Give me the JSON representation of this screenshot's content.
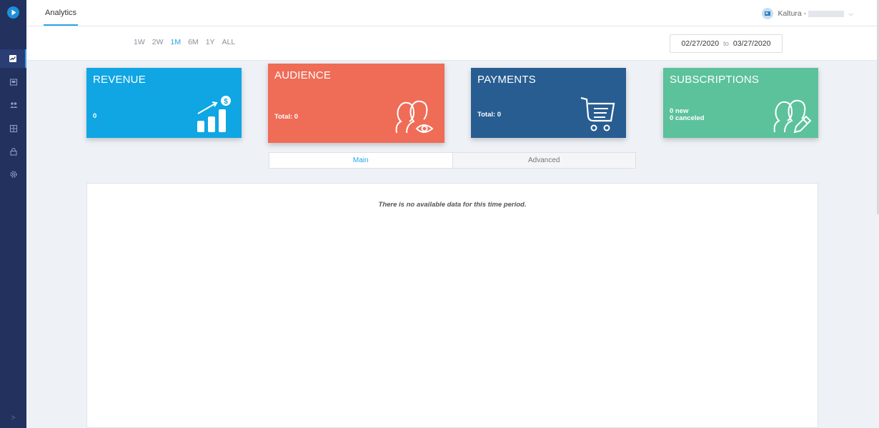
{
  "header": {
    "tab_label": "Analytics",
    "account_label": "Kaltura -"
  },
  "toolbar": {
    "periods": [
      {
        "label": "1W",
        "active": false
      },
      {
        "label": "2W",
        "active": false
      },
      {
        "label": "1M",
        "active": true
      },
      {
        "label": "6M",
        "active": false
      },
      {
        "label": "1Y",
        "active": false
      },
      {
        "label": "ALL",
        "active": false
      }
    ],
    "date_from": "02/27/2020",
    "date_sep": "to",
    "date_to": "03/27/2020"
  },
  "cards": {
    "revenue": {
      "title": "REVENUE",
      "value": "0",
      "color": "#0fa6e3",
      "icon": "revenue-growth-icon"
    },
    "audience": {
      "title": "AUDIENCE",
      "value": "Total: 0",
      "color": "#ef6c57",
      "icon": "audience-eye-icon"
    },
    "payments": {
      "title": "PAYMENTS",
      "value": "Total: 0",
      "color": "#275d91",
      "icon": "shopping-cart-icon"
    },
    "subscriptions": {
      "title": "SUBSCRIPTIONS",
      "value_new": "0 new",
      "value_canceled": "0 canceled",
      "color": "#5cc29b",
      "icon": "users-edit-icon"
    }
  },
  "subtabs": {
    "main": "Main",
    "advanced": "Advanced"
  },
  "panel": {
    "empty_message": "There is no available data for this time period."
  },
  "sidebar": {
    "icons": [
      "logo-play-icon",
      "dashboard-icon",
      "media-icon",
      "users-icon",
      "grid-icon",
      "lock-icon",
      "settings-icon"
    ],
    "expand_glyph": ">"
  },
  "colors": {
    "accent": "#2aa4e8",
    "rail": "#22315e"
  }
}
